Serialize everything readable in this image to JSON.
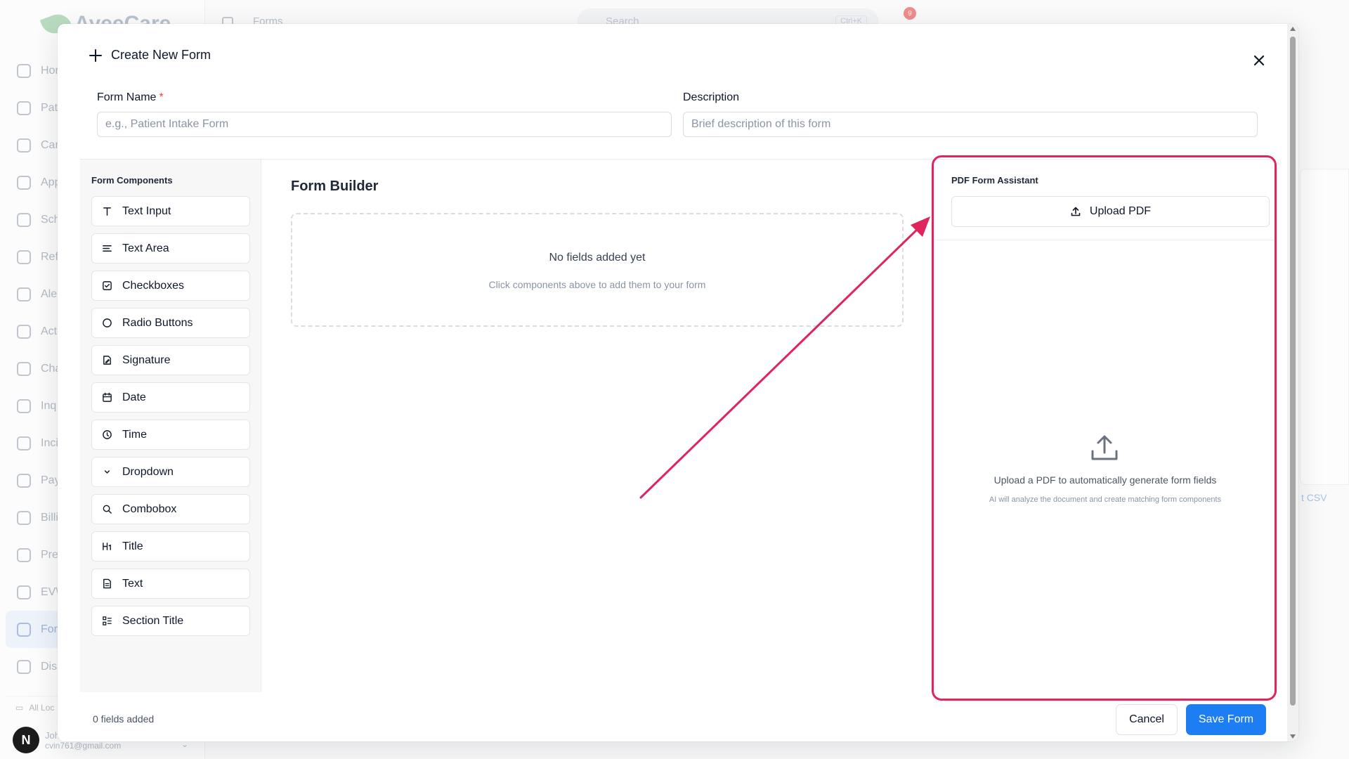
{
  "background": {
    "logo": "AyeeCare",
    "header_crumb": "Forms",
    "search_placeholder": "Search",
    "search_shortcut": "Ctrl+K",
    "notification_count": "9",
    "nav_items": [
      "Hor",
      "Pat",
      "Car",
      "App",
      "Sch",
      "Ref",
      "Ale",
      "Act",
      "Cha",
      "Inq",
      "Inci",
      "Pay",
      "Billi",
      "Pre",
      "EV\\",
      "For",
      "Dis"
    ],
    "active_nav_index": 15,
    "locations_label": "All Loc",
    "user_name": "Joh",
    "user_email": "cvin761@gmail.com",
    "user_initial": "N",
    "export_text": "t CSV"
  },
  "modal": {
    "title": "Create New Form",
    "form_name_label": "Form Name",
    "form_name_required_mark": "*",
    "form_name_value": "",
    "form_name_placeholder": "e.g., Patient Intake Form",
    "description_label": "Description",
    "description_value": "",
    "description_placeholder": "Brief description of this form"
  },
  "components_panel": {
    "heading": "Form Components",
    "items": [
      {
        "label": "Text Input",
        "icon": "type-icon"
      },
      {
        "label": "Text Area",
        "icon": "align-left-icon"
      },
      {
        "label": "Checkboxes",
        "icon": "checkbox-icon"
      },
      {
        "label": "Radio Buttons",
        "icon": "radio-icon"
      },
      {
        "label": "Signature",
        "icon": "signature-icon"
      },
      {
        "label": "Date",
        "icon": "calendar-icon"
      },
      {
        "label": "Time",
        "icon": "clock-icon"
      },
      {
        "label": "Dropdown",
        "icon": "chevron-down-icon"
      },
      {
        "label": "Combobox",
        "icon": "search-icon"
      },
      {
        "label": "Title",
        "icon": "heading-icon"
      },
      {
        "label": "Text",
        "icon": "file-text-icon"
      },
      {
        "label": "Section Title",
        "icon": "list-icon"
      }
    ]
  },
  "builder": {
    "title": "Form Builder",
    "empty_title": "No fields added yet",
    "empty_subtitle": "Click components above to add them to your form"
  },
  "pdf_assistant": {
    "heading": "PDF Form Assistant",
    "upload_label": "Upload PDF",
    "empty_title": "Upload a PDF to automatically generate form fields",
    "empty_subtitle": "AI will analyze the document and create matching form components"
  },
  "footer": {
    "fields_count": "0 fields added",
    "cancel_label": "Cancel",
    "save_label": "Save Form"
  },
  "colors": {
    "accent": "#1d7df2",
    "highlight": "#e0245e",
    "required": "#ef4444"
  }
}
